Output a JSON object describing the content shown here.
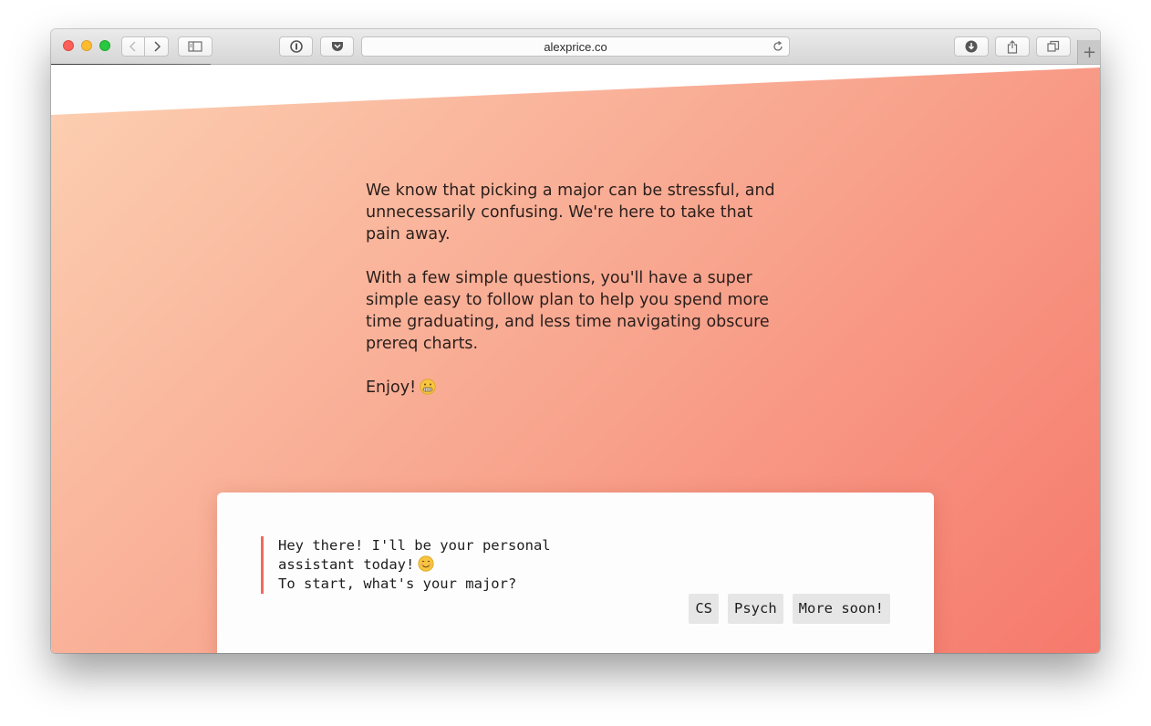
{
  "browser": {
    "url": "alexprice.co",
    "new_tab_label": "+"
  },
  "intro": {
    "paragraph1": "We know that picking a major can be stressful, and unnecessarily confusing. We're here to take that pain away.",
    "paragraph2": "With a few simple questions, you'll have a super simple easy to follow plan to help you spend more time graduating, and less time navigating obscure prereq charts.",
    "closing": "Enjoy!",
    "closing_emoji": "grimacing-face-emoji"
  },
  "chat": {
    "line1": "Hey there! I'll be your personal",
    "line2": "assistant today!",
    "line2_emoji": "smiling-face-emoji",
    "line3": "To start, what's your major?",
    "choices": [
      "CS",
      "Psych",
      "More soon!"
    ]
  },
  "colors": {
    "gradient_start": "#fcd0b2",
    "gradient_end": "#f6796c",
    "accent_bar": "#f06a5f"
  }
}
